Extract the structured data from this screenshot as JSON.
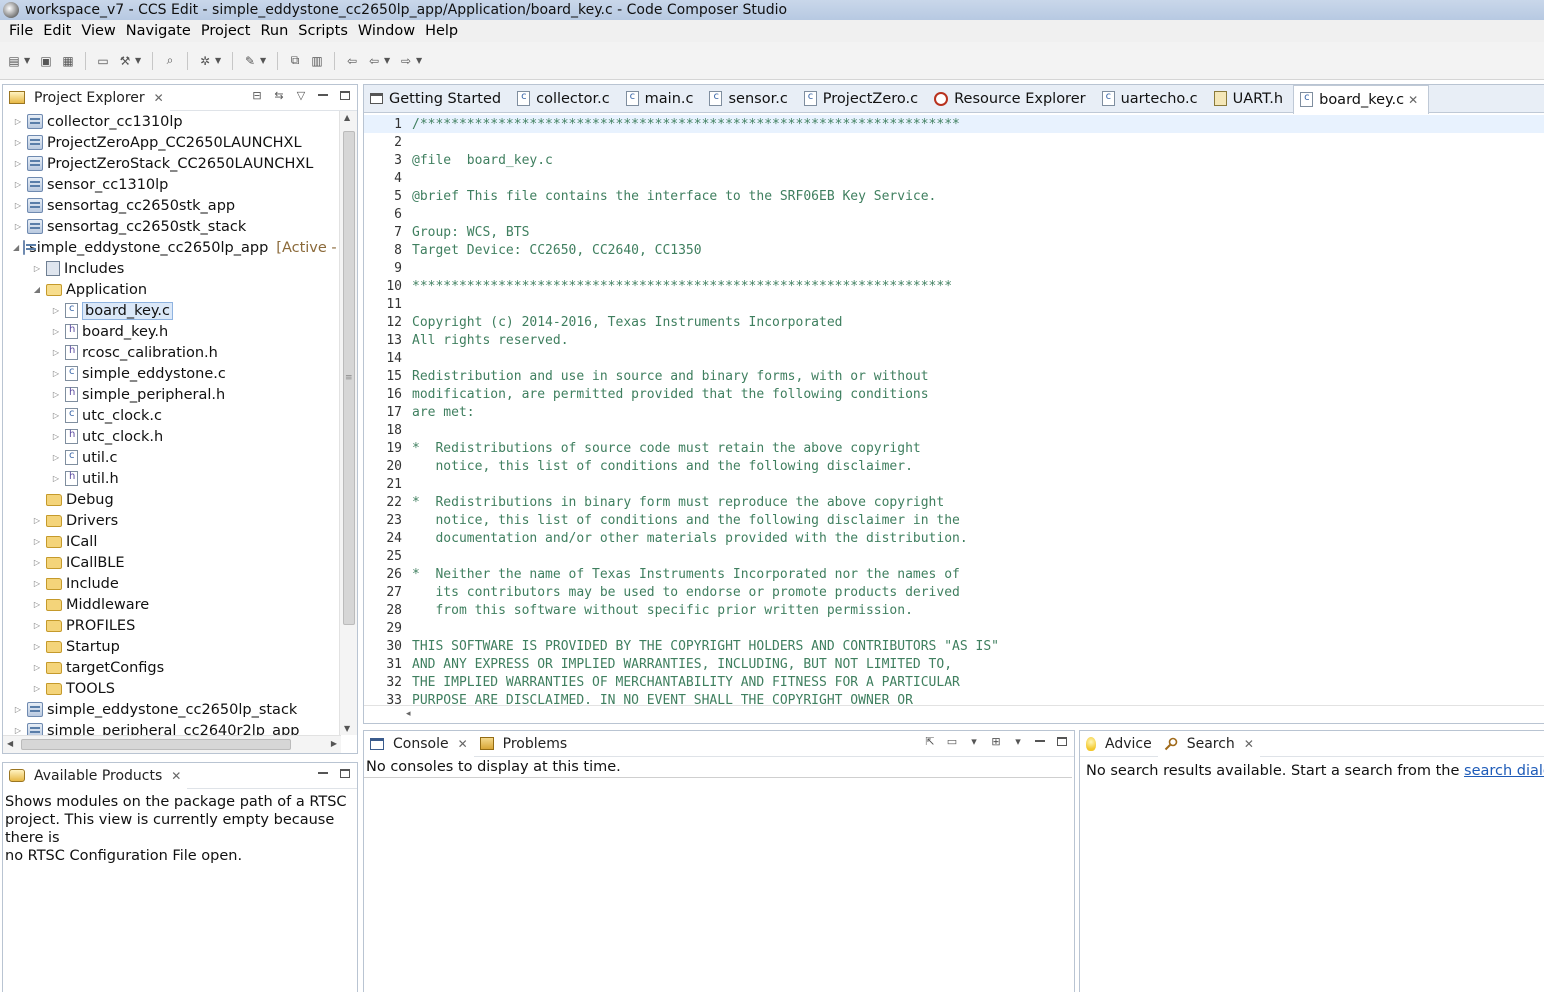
{
  "window": {
    "title": "workspace_v7 - CCS Edit - simple_eddystone_cc2650lp_app/Application/board_key.c - Code Composer Studio"
  },
  "menubar": [
    "File",
    "Edit",
    "View",
    "Navigate",
    "Project",
    "Run",
    "Scripts",
    "Window",
    "Help"
  ],
  "project_explorer": {
    "title": "Project Explorer",
    "items": [
      {
        "label": "collector_cc1310lp",
        "type": "project",
        "level": 0,
        "twisty": "closed"
      },
      {
        "label": "ProjectZeroApp_CC2650LAUNCHXL",
        "type": "project",
        "level": 0,
        "twisty": "closed"
      },
      {
        "label": "ProjectZeroStack_CC2650LAUNCHXL",
        "type": "project",
        "level": 0,
        "twisty": "closed"
      },
      {
        "label": "sensor_cc1310lp",
        "type": "project",
        "level": 0,
        "twisty": "closed"
      },
      {
        "label": "sensortag_cc2650stk_app",
        "type": "project",
        "level": 0,
        "twisty": "closed"
      },
      {
        "label": "sensortag_cc2650stk_stack",
        "type": "project",
        "level": 0,
        "twisty": "closed"
      },
      {
        "label": "simple_eddystone_cc2650lp_app",
        "type": "project",
        "level": 0,
        "twisty": "open",
        "tag": "[Active - I"
      },
      {
        "label": "Includes",
        "type": "includes",
        "level": 1,
        "twisty": "closed"
      },
      {
        "label": "Application",
        "type": "folder-open",
        "level": 1,
        "twisty": "open"
      },
      {
        "label": "board_key.c",
        "type": "file-c",
        "level": 2,
        "twisty": "closed",
        "selected": true
      },
      {
        "label": "board_key.h",
        "type": "file-h",
        "level": 2,
        "twisty": "closed"
      },
      {
        "label": "rcosc_calibration.h",
        "type": "file-h",
        "level": 2,
        "twisty": "closed"
      },
      {
        "label": "simple_eddystone.c",
        "type": "file-c",
        "level": 2,
        "twisty": "closed"
      },
      {
        "label": "simple_peripheral.h",
        "type": "file-h",
        "level": 2,
        "twisty": "closed"
      },
      {
        "label": "utc_clock.c",
        "type": "file-c",
        "level": 2,
        "twisty": "closed"
      },
      {
        "label": "utc_clock.h",
        "type": "file-h",
        "level": 2,
        "twisty": "closed"
      },
      {
        "label": "util.c",
        "type": "file-c",
        "level": 2,
        "twisty": "closed"
      },
      {
        "label": "util.h",
        "type": "file-h",
        "level": 2,
        "twisty": "closed"
      },
      {
        "label": "Debug",
        "type": "folder",
        "level": 1,
        "twisty": "none"
      },
      {
        "label": "Drivers",
        "type": "folder",
        "level": 1,
        "twisty": "closed"
      },
      {
        "label": "ICall",
        "type": "folder",
        "level": 1,
        "twisty": "closed"
      },
      {
        "label": "ICallBLE",
        "type": "folder",
        "level": 1,
        "twisty": "closed"
      },
      {
        "label": "Include",
        "type": "folder",
        "level": 1,
        "twisty": "closed"
      },
      {
        "label": "Middleware",
        "type": "folder",
        "level": 1,
        "twisty": "closed"
      },
      {
        "label": "PROFILES",
        "type": "folder",
        "level": 1,
        "twisty": "closed"
      },
      {
        "label": "Startup",
        "type": "folder",
        "level": 1,
        "twisty": "closed"
      },
      {
        "label": "targetConfigs",
        "type": "folder",
        "level": 1,
        "twisty": "closed"
      },
      {
        "label": "TOOLS",
        "type": "folder",
        "level": 1,
        "twisty": "closed"
      },
      {
        "label": "simple_eddystone_cc2650lp_stack",
        "type": "project",
        "level": 0,
        "twisty": "closed"
      },
      {
        "label": "simple_peripheral_cc2640r2lp_app",
        "type": "project",
        "level": 0,
        "twisty": "closed"
      }
    ]
  },
  "available_products": {
    "title": "Available Products",
    "lines": [
      "Shows modules on the package path of a RTSC",
      "project. This view is currently empty because there is",
      "no RTSC Configuration File open."
    ]
  },
  "editor": {
    "tabs": [
      {
        "label": "Getting Started",
        "icon": "getting-started",
        "active": false
      },
      {
        "label": "collector.c",
        "icon": "file-c",
        "active": false
      },
      {
        "label": "main.c",
        "icon": "file-c",
        "active": false
      },
      {
        "label": "sensor.c",
        "icon": "file-c",
        "active": false
      },
      {
        "label": "ProjectZero.c",
        "icon": "file-c",
        "active": false
      },
      {
        "label": "Resource Explorer",
        "icon": "resource",
        "active": false
      },
      {
        "label": "uartecho.c",
        "icon": "file-c",
        "active": false
      },
      {
        "label": "UART.h",
        "icon": "file-h-alt",
        "active": false
      },
      {
        "label": "board_key.c",
        "icon": "file-c",
        "active": true
      }
    ],
    "lines": [
      "/*********************************************************************",
      "",
      "@file  board_key.c",
      "",
      "@brief This file contains the interface to the SRF06EB Key Service.",
      "",
      "Group: WCS, BTS",
      "Target Device: CC2650, CC2640, CC1350",
      "",
      "*********************************************************************",
      "",
      "Copyright (c) 2014-2016, Texas Instruments Incorporated",
      "All rights reserved.",
      "",
      "Redistribution and use in source and binary forms, with or without",
      "modification, are permitted provided that the following conditions",
      "are met:",
      "",
      "*  Redistributions of source code must retain the above copyright",
      "   notice, this list of conditions and the following disclaimer.",
      "",
      "*  Redistributions in binary form must reproduce the above copyright",
      "   notice, this list of conditions and the following disclaimer in the",
      "   documentation and/or other materials provided with the distribution.",
      "",
      "*  Neither the name of Texas Instruments Incorporated nor the names of",
      "   its contributors may be used to endorse or promote products derived",
      "   from this software without specific prior written permission.",
      "",
      "THIS SOFTWARE IS PROVIDED BY THE COPYRIGHT HOLDERS AND CONTRIBUTORS \"AS IS\"",
      "AND ANY EXPRESS OR IMPLIED WARRANTIES, INCLUDING, BUT NOT LIMITED TO,",
      "THE IMPLIED WARRANTIES OF MERCHANTABILITY AND FITNESS FOR A PARTICULAR",
      "PURPOSE ARE DISCLAIMED. IN NO EVENT SHALL THE COPYRIGHT OWNER OR"
    ]
  },
  "console": {
    "tabs": [
      "Console",
      "Problems"
    ],
    "message": "No consoles to display at this time."
  },
  "search": {
    "tabs": [
      "Advice",
      "Search"
    ],
    "message_prefix": "No search results available. Start a search from the ",
    "link": "search dialog..."
  },
  "colors": {
    "code_comment": "#3f7f5f",
    "link": "#1e5bb8",
    "selection": "#dbe8f8"
  }
}
